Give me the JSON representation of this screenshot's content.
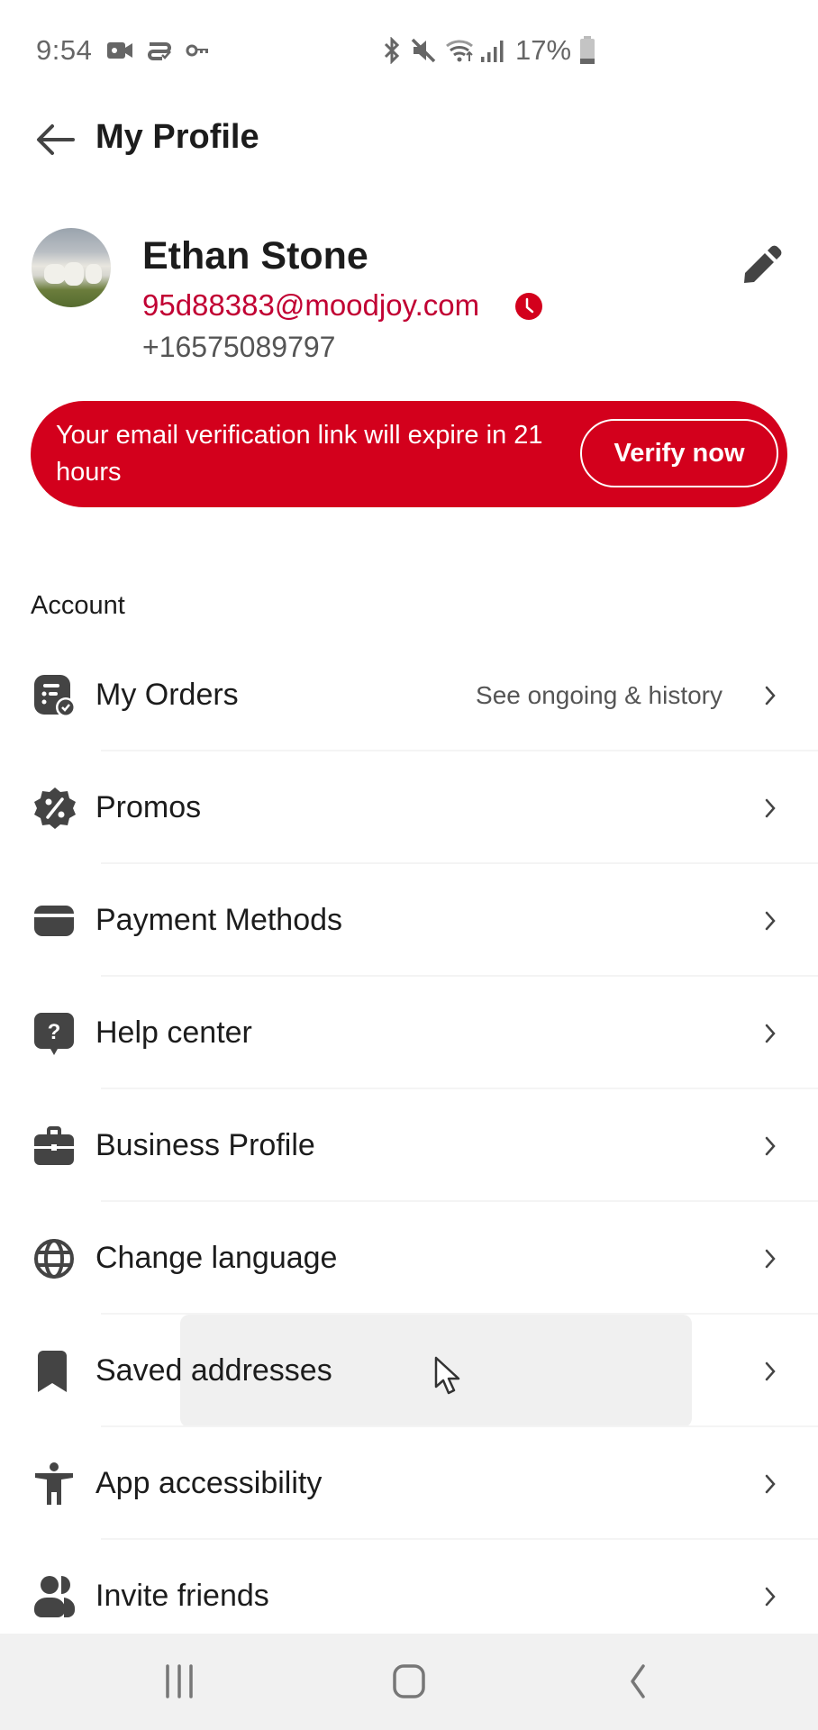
{
  "status_bar": {
    "time": "9:54",
    "left_icons": [
      "video-camera-icon",
      "cast-check-icon",
      "vpn-key-icon"
    ],
    "right_icons": [
      "bluetooth-icon",
      "mute-icon",
      "wifi-icon",
      "signal-icon"
    ],
    "battery_percent": "17%",
    "battery_level": 0.17
  },
  "header": {
    "back_icon": "arrow-left-icon",
    "title": "My Profile"
  },
  "profile": {
    "name": "Ethan Stone",
    "email": "95d88383@moodjoy.com",
    "email_status_icon": "clock-pending-icon",
    "phone": "+16575089797",
    "edit_icon": "pencil-icon"
  },
  "banner": {
    "message": "Your email verification link will expire in 21 hours",
    "button_label": "Verify now",
    "color": "#d3001c"
  },
  "account": {
    "section_title": "Account",
    "items": [
      {
        "label": "My Orders",
        "subtitle": "See ongoing & history",
        "icon": "orders-icon"
      },
      {
        "label": "Promos",
        "subtitle": "",
        "icon": "promo-badge-icon"
      },
      {
        "label": "Payment Methods",
        "subtitle": "",
        "icon": "card-icon"
      },
      {
        "label": "Help center",
        "subtitle": "",
        "icon": "help-bubble-icon"
      },
      {
        "label": "Business Profile",
        "subtitle": "",
        "icon": "briefcase-icon"
      },
      {
        "label": "Change language",
        "subtitle": "",
        "icon": "globe-icon"
      },
      {
        "label": "Saved addresses",
        "subtitle": "",
        "icon": "bookmark-icon"
      },
      {
        "label": "App accessibility",
        "subtitle": "",
        "icon": "accessibility-icon"
      },
      {
        "label": "Invite friends",
        "subtitle": "",
        "icon": "people-icon"
      }
    ]
  },
  "nav_bar": {
    "buttons": [
      "recent-apps",
      "home",
      "back"
    ]
  },
  "colors": {
    "accent": "#d3001c",
    "email_text": "#c10033",
    "icon": "#444444"
  }
}
